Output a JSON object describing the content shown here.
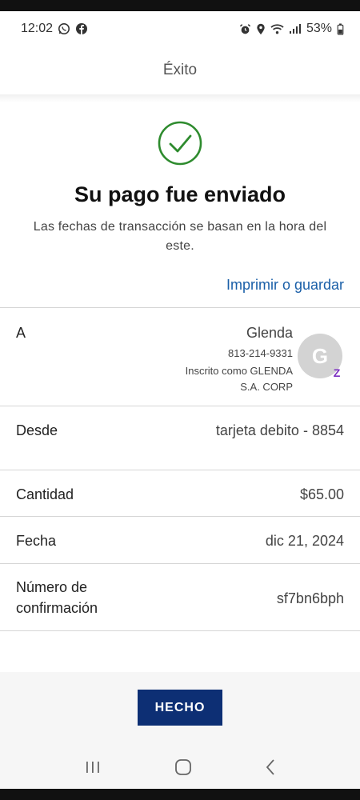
{
  "status_bar": {
    "time": "12:02",
    "battery": "53%",
    "left_icons": [
      "whatsapp-icon",
      "facebook-icon"
    ],
    "right_icons": [
      "alarm-icon",
      "location-icon",
      "wifi-icon",
      "signal-icon",
      "battery-icon"
    ]
  },
  "header": {
    "title": "Éxito"
  },
  "success": {
    "icon": "checkmark-circle-icon",
    "headline": "Su pago fue enviado",
    "subtext": "Las fechas de transacción se basan en la hora del este.",
    "print_link": "Imprimir o guardar"
  },
  "details": {
    "to": {
      "label": "A",
      "name": "Glenda",
      "phone": "813-214-9331",
      "enrolled_line1": "Inscrito como GLENDA",
      "enrolled_line2": "S.A. CORP",
      "avatar_initial": "G",
      "badge": "Z"
    },
    "from": {
      "label": "Desde",
      "value": "tarjeta debito - 8854"
    },
    "amount": {
      "label": "Cantidad",
      "value": "$65.00"
    },
    "date": {
      "label": "Fecha",
      "value": "dic 21, 2024"
    },
    "confirmation": {
      "label_line1": "Número de",
      "label_line2": "confirmación",
      "value": "sf7bn6bph"
    }
  },
  "actions": {
    "done_label": "HECHO"
  },
  "colors": {
    "accent": "#0d2f74",
    "link": "#1a5fa8",
    "success": "#2e8b2e",
    "zelle": "#7b2fc0"
  },
  "nav": [
    "recent-apps-icon",
    "home-icon",
    "back-icon"
  ]
}
